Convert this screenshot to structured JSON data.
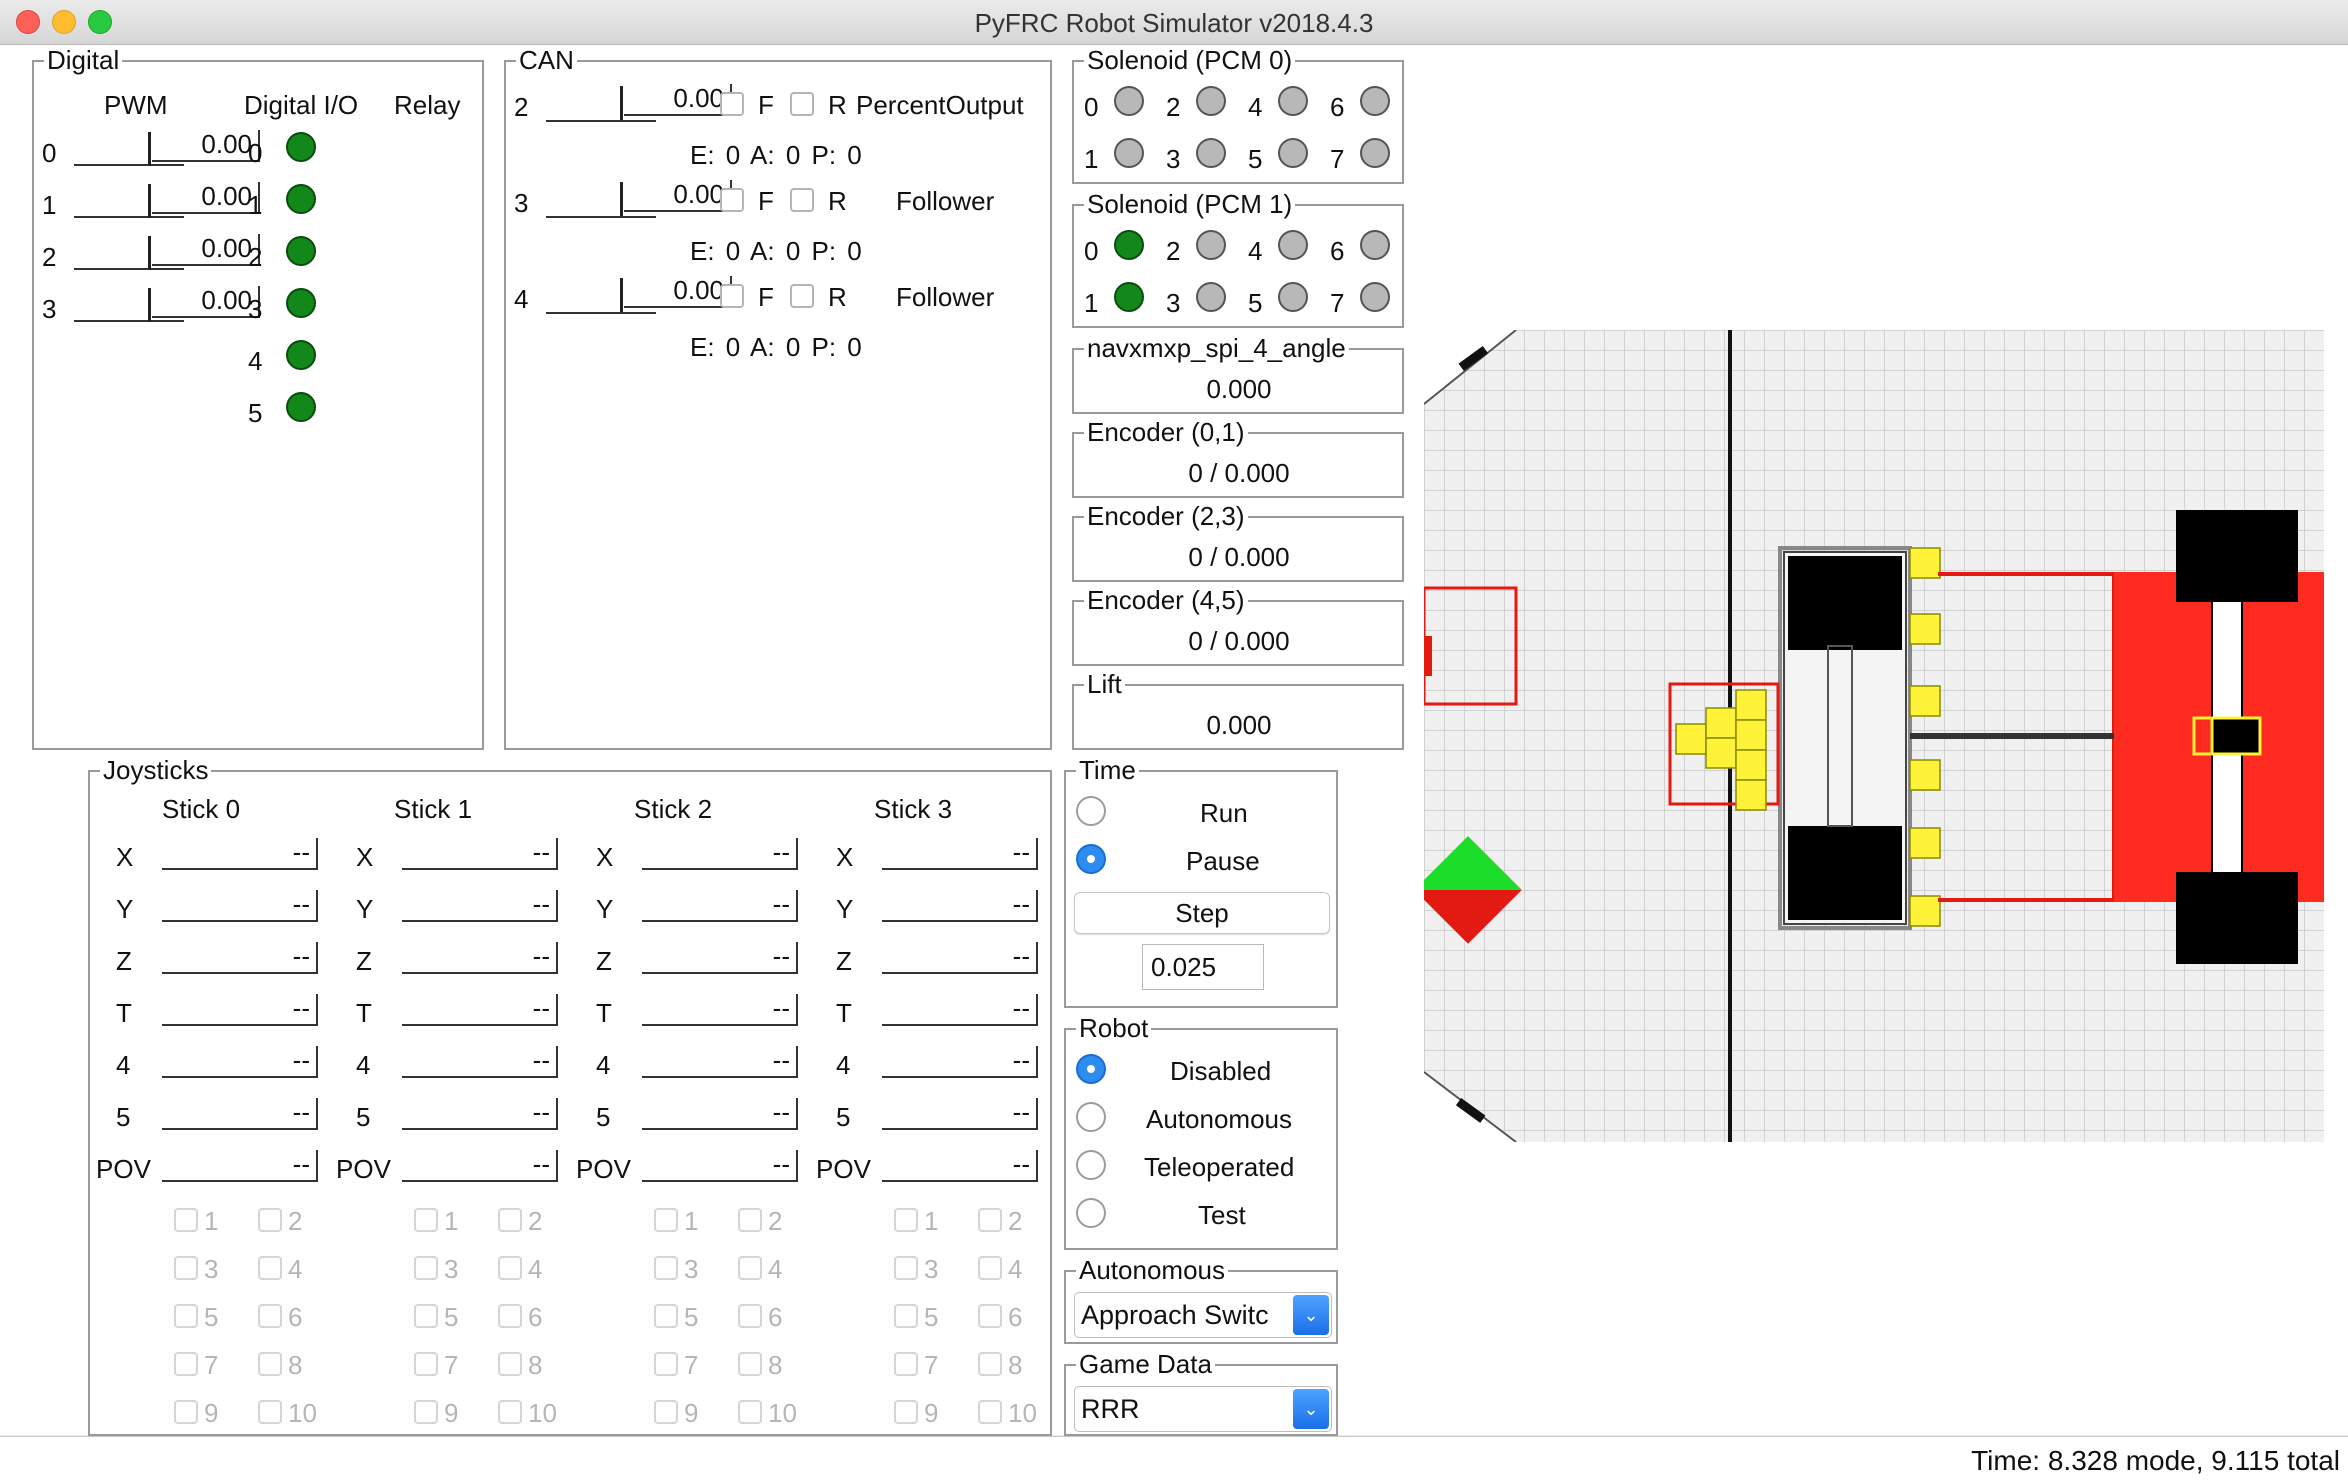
{
  "window": {
    "title": "PyFRC Robot Simulator v2018.4.3"
  },
  "digital": {
    "title": "Digital",
    "headers": {
      "pwm": "PWM",
      "dio": "Digital I/O",
      "relay": "Relay"
    },
    "pwm": [
      {
        "label": "0",
        "value": "0.00"
      },
      {
        "label": "1",
        "value": "0.00"
      },
      {
        "label": "2",
        "value": "0.00"
      },
      {
        "label": "3",
        "value": "0.00"
      }
    ],
    "dio": [
      "0",
      "1",
      "2",
      "3",
      "4",
      "5"
    ]
  },
  "can": {
    "title": "CAN",
    "devices": [
      {
        "id": "2",
        "value": "0.00",
        "f": "F",
        "r": "R",
        "mode": "PercentOutput",
        "status": "E: 0  A: 0  P: 0"
      },
      {
        "id": "3",
        "value": "0.00",
        "f": "F",
        "r": "R",
        "mode": "Follower",
        "status": "E: 0  A: 0  P: 0"
      },
      {
        "id": "4",
        "value": "0.00",
        "f": "F",
        "r": "R",
        "mode": "Follower",
        "status": "E: 0  A: 0  P: 0"
      }
    ]
  },
  "solenoid0": {
    "title": "Solenoid (PCM 0)",
    "top": [
      "0",
      "2",
      "4",
      "6"
    ],
    "bottom": [
      "1",
      "3",
      "5",
      "7"
    ]
  },
  "solenoid1": {
    "title": "Solenoid (PCM 1)",
    "top": [
      "0",
      "2",
      "4",
      "6"
    ],
    "bottom": [
      "1",
      "3",
      "5",
      "7"
    ]
  },
  "sensors": [
    {
      "title": "navxmxp_spi_4_angle",
      "value": "0.000"
    },
    {
      "title": "Encoder (0,1)",
      "value": "0 / 0.000"
    },
    {
      "title": "Encoder (2,3)",
      "value": "0 / 0.000"
    },
    {
      "title": "Encoder (4,5)",
      "value": "0 / 0.000"
    },
    {
      "title": "Lift",
      "value": "0.000"
    }
  ],
  "joysticks": {
    "title": "Joysticks",
    "sticks": [
      "Stick 0",
      "Stick 1",
      "Stick 2",
      "Stick 3"
    ],
    "axes": [
      "X",
      "Y",
      "Z",
      "T",
      "4",
      "5",
      "POV"
    ],
    "axis_value": "--",
    "buttons": [
      "1",
      "2",
      "3",
      "4",
      "5",
      "6",
      "7",
      "8",
      "9",
      "10"
    ]
  },
  "time": {
    "title": "Time",
    "run": "Run",
    "pause": "Pause",
    "step": "Step",
    "step_value": "0.025"
  },
  "robot": {
    "title": "Robot",
    "modes": [
      "Disabled",
      "Autonomous",
      "Teleoperated",
      "Test"
    ]
  },
  "autonomous": {
    "title": "Autonomous",
    "selected": "Approach Switc"
  },
  "game_data": {
    "title": "Game Data",
    "selected": "RRR"
  },
  "status": {
    "text": "Time: 8.328 mode, 9.115 total"
  },
  "colors": {
    "led_on": "#13881a",
    "field_red": "#fd2a1f",
    "robot_yellow": "#fff33a",
    "select_blue": "#2d8cf0"
  }
}
